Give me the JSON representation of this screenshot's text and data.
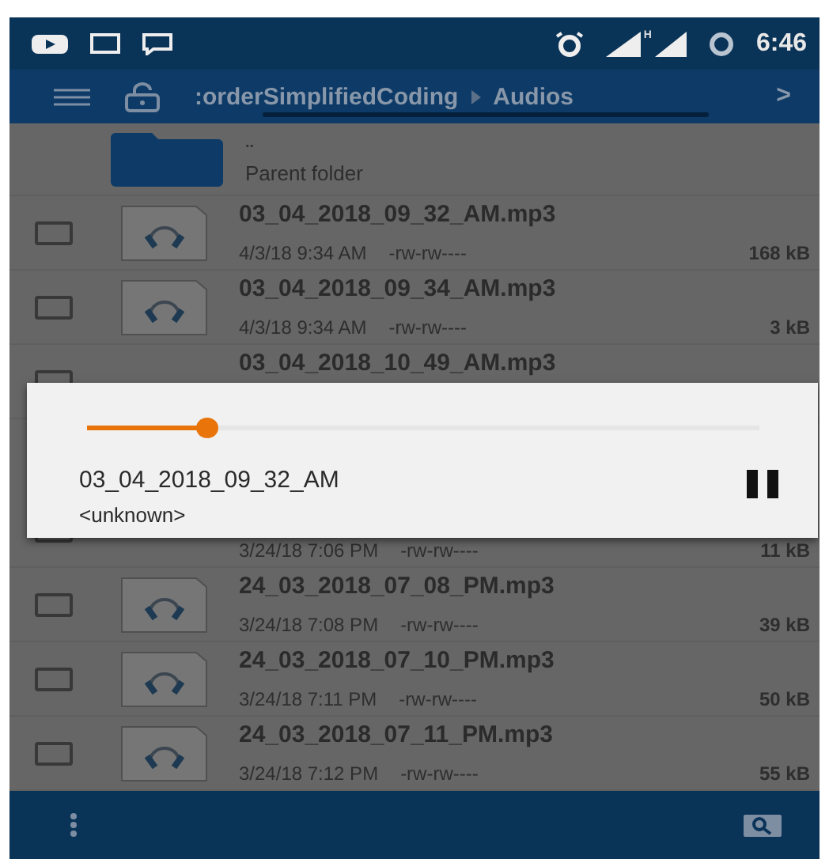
{
  "status_bar": {
    "network_type": "H",
    "time": "6:46"
  },
  "toolbar": {
    "breadcrumb": [
      {
        "label": ":orderSimplifiedCoding"
      },
      {
        "label": "Audios"
      }
    ],
    "forward": ">"
  },
  "parent_folder": {
    "name": "..",
    "label": "Parent folder"
  },
  "files": [
    {
      "name": "03_04_2018_09_32_AM.mp3",
      "date": "4/3/18 9:34 AM",
      "permissions": "-rw-rw----",
      "size": "168 kB",
      "checked": false
    },
    {
      "name": "03_04_2018_09_34_AM.mp3",
      "date": "4/3/18 9:34 AM",
      "permissions": "-rw-rw----",
      "size": "3 kB",
      "checked": false
    },
    {
      "name": "03_04_2018_10_49_AM.mp3",
      "checked": false
    },
    {
      "date": "3/24/18 7:06 PM",
      "permissions": "-rw-rw----",
      "size": "11 kB",
      "checked": false
    },
    {
      "name": "24_03_2018_07_08_PM.mp3",
      "date": "3/24/18 7:08 PM",
      "permissions": "-rw-rw----",
      "size": "39 kB",
      "checked": false
    },
    {
      "name": "24_03_2018_07_10_PM.mp3",
      "date": "3/24/18 7:11 PM",
      "permissions": "-rw-rw----",
      "size": "50 kB",
      "checked": false
    },
    {
      "name": "24_03_2018_07_11_PM.mp3",
      "date": "3/24/18 7:12 PM",
      "permissions": "-rw-rw----",
      "size": "55 kB",
      "checked": false
    }
  ],
  "player": {
    "title": "03_04_2018_09_32_AM",
    "artist": "<unknown>",
    "level": 0.18,
    "playing": true
  }
}
